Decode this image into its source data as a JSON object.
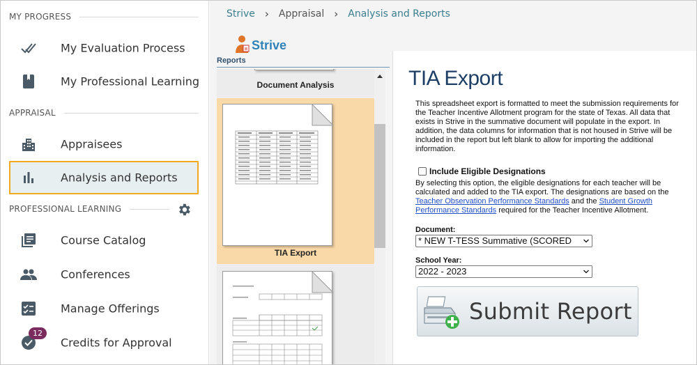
{
  "sidebar": {
    "sections": [
      {
        "label": "MY PROGRESS"
      },
      {
        "label": "APPRAISAL"
      },
      {
        "label": "PROFESSIONAL LEARNING"
      }
    ],
    "items": [
      {
        "label": "My Evaluation Process",
        "icon": "double-check-icon"
      },
      {
        "label": "My Professional Learning",
        "icon": "book-icon"
      },
      {
        "label": "Appraisees",
        "icon": "building-icon"
      },
      {
        "label": "Analysis and Reports",
        "icon": "bar-chart-icon",
        "active": true
      },
      {
        "label": "Course Catalog",
        "icon": "library-icon"
      },
      {
        "label": "Conferences",
        "icon": "people-icon"
      },
      {
        "label": "Manage Offerings",
        "icon": "checklist-icon"
      },
      {
        "label": "Credits for Approval",
        "icon": "verified-icon",
        "badge": "12"
      }
    ],
    "settings_icon": "gear-icon"
  },
  "breadcrumb": {
    "items": [
      "Strive",
      "Appraisal",
      "Analysis and Reports"
    ]
  },
  "logo": {
    "text": "Strive"
  },
  "reports": {
    "label": "Reports",
    "items": [
      {
        "title": "Document Analysis"
      },
      {
        "title": "TIA Export",
        "selected": true
      },
      {
        "title": ""
      }
    ]
  },
  "panel": {
    "title": "TIA Export",
    "description": "This spreadsheet export is formatted to meet the submission requirements for the Teacher Incentive Allotment program for the state of Texas. All data that exists in Strive in the summative document will populate in the export. In addition, the data columns for information that is not housed in Strive will be included in the report but left blank to allow for importing the additional information.",
    "checkbox_label": "Include Eligible Designations",
    "checkbox_checked": false,
    "designations_text_1": "By selecting this option, the eligible designations for each teacher will be calculated and added to the TIA export. The designations are based on the ",
    "link_1": "Teacher Observation Performance Standards",
    "designations_text_2": " and the ",
    "link_2": "Student Growth Performance Standards",
    "designations_text_3": " required for the Teacher Incentive Allotment.",
    "document_label": "Document:",
    "document_value": "* NEW T-TESS Summative (SCORED",
    "school_year_label": "School Year:",
    "school_year_value": "2022 - 2023",
    "submit_label": "Submit Report"
  },
  "colors": {
    "accent_teal": "#3a7e8f",
    "active_border": "#f2a91d",
    "badge": "#7b2b5e",
    "selected_report": "#fad9a8",
    "title_blue": "#1d3f66",
    "link_blue": "#1f4ec9"
  }
}
